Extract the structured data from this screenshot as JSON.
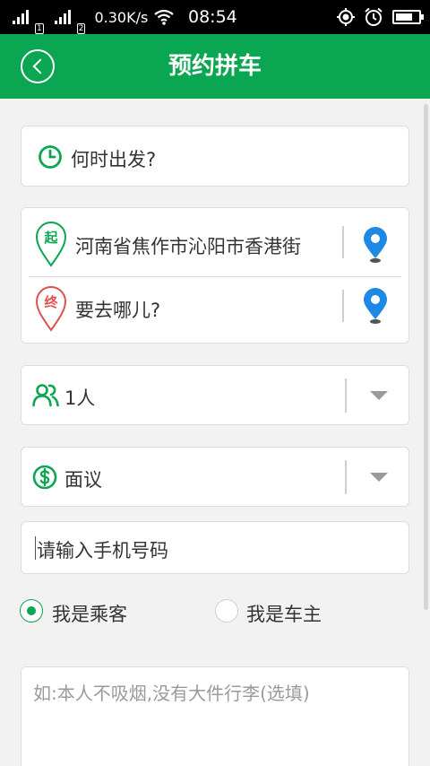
{
  "status_bar": {
    "net_speed": "0.30K/s",
    "time": "08:54",
    "sim1": "1",
    "sim2": "2"
  },
  "header": {
    "title": "预约拼车"
  },
  "form": {
    "departure_time": {
      "placeholder": "何时出发?",
      "icon": "clock-icon"
    },
    "origin": {
      "badge": "起",
      "value": "河南省焦作市沁阳市香港街",
      "icon": "location-pin-icon"
    },
    "destination": {
      "badge": "终",
      "placeholder": "要去哪儿?",
      "icon": "location-pin-icon"
    },
    "passengers": {
      "value": "1人",
      "icon": "people-icon"
    },
    "price": {
      "value": "面议",
      "icon": "dollar-icon"
    },
    "phone": {
      "placeholder": "请输入手机号码"
    },
    "roles": [
      {
        "label": "我是乘客",
        "selected": true
      },
      {
        "label": "我是车主",
        "selected": false
      }
    ],
    "remark": {
      "placeholder": "如:本人不吸烟,没有大件行李(选填)"
    }
  },
  "colors": {
    "brand": "#0aa651",
    "origin_badge": "#0aa651",
    "destination_badge": "#e05050",
    "pin": "#1e88e5"
  }
}
